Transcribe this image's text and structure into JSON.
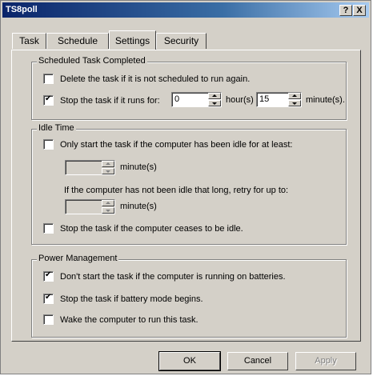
{
  "window": {
    "title": "TS8poll",
    "help_btn": "?",
    "close_btn": "X"
  },
  "tabs": [
    {
      "label": "Task"
    },
    {
      "label": "Schedule"
    },
    {
      "label": "Settings"
    },
    {
      "label": "Security"
    }
  ],
  "active_tab": "Settings",
  "scheduled": {
    "title": "Scheduled Task Completed",
    "delete_label": "Delete the task if it is not scheduled to run again.",
    "delete_checked": false,
    "stop_label": "Stop the task if it runs for:",
    "stop_checked": true,
    "hours_value": "0",
    "hours_unit": "hour(s)",
    "minutes_value": "15",
    "minutes_unit": "minute(s)."
  },
  "idle": {
    "title": "Idle Time",
    "only_start_label": "Only start the task if the computer has been idle for at least:",
    "only_start_checked": false,
    "idle_minutes_unit": "minute(s)",
    "retry_text": "If the computer has not been idle that long, retry for up to:",
    "retry_minutes_unit": "minute(s)",
    "stop_idle_label": "Stop the task if the computer ceases to be idle.",
    "stop_idle_checked": false
  },
  "power": {
    "title": "Power Management",
    "batteries_label": "Don't start the task if the computer is running on batteries.",
    "batteries_checked": true,
    "battery_mode_label": "Stop the task if battery mode begins.",
    "battery_mode_checked": true,
    "wake_label": "Wake the computer to run this task.",
    "wake_checked": false
  },
  "buttons": {
    "ok": "OK",
    "cancel": "Cancel",
    "apply": "Apply"
  }
}
